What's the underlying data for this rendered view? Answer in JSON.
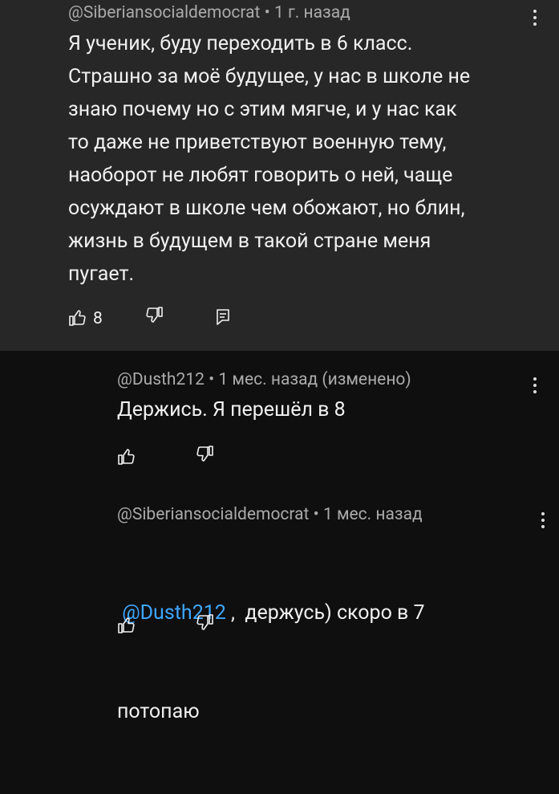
{
  "comments": [
    {
      "author": "@Siberiansocialdemocrat",
      "separator": " • ",
      "time": "1 г. назад",
      "text_lines": [
        "Я ученик, буду переходить в 6 класс.",
        "Страшно за моё будущее, у нас в школе не",
        "знаю почему но с этим мягче, и у нас как",
        "то даже не приветствуют военную тему,",
        "наоборот не любят говорить о ней, чаще",
        "осуждают в школе чем обожают, но блин,",
        "жизнь в будущем в такой стране меня",
        "пугает."
      ],
      "likes": "8",
      "icons": [
        "thumb-up-icon",
        "thumb-down-icon",
        "reply-icon",
        "more-vert-icon"
      ]
    },
    {
      "author": "@Dusth212",
      "separator": " • ",
      "time": "1 мес. назад (изменено)",
      "text": "Держись. Я перешёл в 8",
      "icons": [
        "thumb-up-icon",
        "thumb-down-icon",
        "more-vert-icon"
      ]
    },
    {
      "author": "@Siberiansocialdemocrat",
      "separator": " • ",
      "time": "1 мес. назад",
      "mention": "@Dusth212",
      "text_after_mention": " ,  держусь) скоро в 7",
      "text_line2": "потопаю",
      "icons": [
        "thumb-up-icon",
        "thumb-down-icon",
        "more-vert-icon"
      ]
    }
  ],
  "colors": {
    "background": "#0f0f0f",
    "highlight": "#272727",
    "meta": "#aaaaaa",
    "mention": "#3ea6ff"
  }
}
